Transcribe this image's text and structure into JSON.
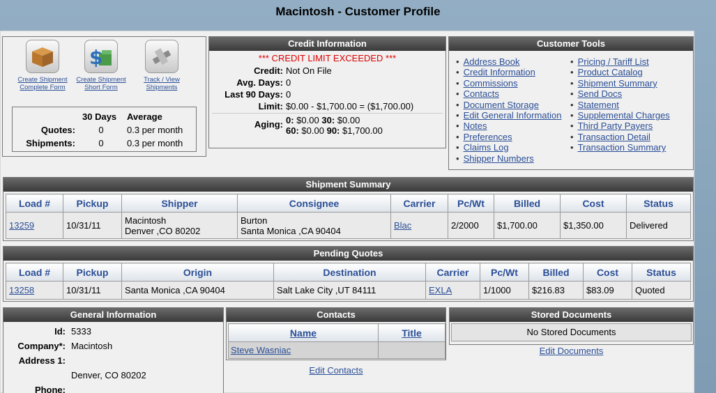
{
  "title": "Macintosh - Customer Profile",
  "actions": [
    {
      "icon": "box-icon",
      "line1": "Create Shipment",
      "line2": "Complete Form"
    },
    {
      "icon": "money-icon",
      "line1": "Create Shipment",
      "line2": "Short Form"
    },
    {
      "icon": "track-icon",
      "line1": "Track / View",
      "line2": "Shipments"
    }
  ],
  "stats": {
    "h_30": "30 Days",
    "h_avg": "Average",
    "quotes_label": "Quotes:",
    "quotes_30": "0",
    "quotes_avg": "0.3 per month",
    "ship_label": "Shipments:",
    "ship_30": "0",
    "ship_avg": "0.3 per month"
  },
  "credit": {
    "title": "Credit Information",
    "warning": "*** CREDIT LIMIT EXCEEDED ***",
    "credit_label": "Credit:",
    "credit_value": "Not On File",
    "avg_label": "Avg. Days:",
    "avg_value": "0",
    "last90_label": "Last 90 Days:",
    "last90_value": "0",
    "limit_label": "Limit:",
    "limit_value": "$0.00 - $1,700.00 = ($1,700.00)",
    "aging_label": "Aging:",
    "aging_0_k": "0:",
    "aging_0_v": "$0.00",
    "aging_30_k": "30:",
    "aging_30_v": "$0.00",
    "aging_60_k": "60:",
    "aging_60_v": "$0.00",
    "aging_90_k": "90:",
    "aging_90_v": "$1,700.00"
  },
  "tools": {
    "title": "Customer Tools",
    "left": [
      "Address Book",
      "Credit Information",
      "Commissions",
      "Contacts",
      "Document Storage",
      "Edit General Information",
      "Notes",
      "Preferences",
      "Claims Log",
      "Shipper Numbers"
    ],
    "right": [
      "Pricing / Tariff List",
      "Product Catalog",
      "Shipment Summary",
      "Send Docs",
      "Statement",
      "Supplemental Charges",
      "Third Party Payers",
      "Transaction Detail",
      "Transaction Summary"
    ]
  },
  "shipments": {
    "title": "Shipment Summary",
    "headers": [
      "Load #",
      "Pickup",
      "Shipper",
      "Consignee",
      "Carrier",
      "Pc/Wt",
      "Billed",
      "Cost",
      "Status"
    ],
    "rows": [
      {
        "load": "13259",
        "pickup": "10/31/11",
        "shipper1": "Macintosh",
        "shipper2": "Denver ,CO 80202",
        "cons1": "Burton",
        "cons2": "Santa Monica ,CA 90404",
        "carrier": "Blac",
        "pcwt": "2/2000",
        "billed": "$1,700.00",
        "cost": "$1,350.00",
        "status": "Delivered"
      }
    ]
  },
  "quotes": {
    "title": "Pending Quotes",
    "headers": [
      "Load #",
      "Pickup",
      "Origin",
      "Destination",
      "Carrier",
      "Pc/Wt",
      "Billed",
      "Cost",
      "Status"
    ],
    "rows": [
      {
        "load": "13258",
        "pickup": "10/31/11",
        "origin": "Santa Monica ,CA 90404",
        "dest": "Salt Lake City ,UT 84111",
        "carrier": "EXLA",
        "pcwt": "1/1000",
        "billed": "$216.83",
        "cost": "$83.09",
        "status": "Quoted"
      }
    ]
  },
  "general": {
    "title": "General Information",
    "id_label": "Id:",
    "id_value": "5333",
    "company_label": "Company*:",
    "company_value": "Macintosh",
    "address_label": "Address 1:",
    "address_value": "",
    "city_value": "Denver, CO 80202",
    "phone_label": "Phone:",
    "phone_value": ""
  },
  "contacts": {
    "title": "Contacts",
    "h_name": "Name",
    "h_title": "Title",
    "rows": [
      {
        "name": "Steve Wasniac",
        "title": ""
      }
    ],
    "edit_link": "Edit Contacts"
  },
  "stored": {
    "title": "Stored Documents",
    "empty": "No Stored Documents",
    "edit_link": "Edit Documents"
  }
}
